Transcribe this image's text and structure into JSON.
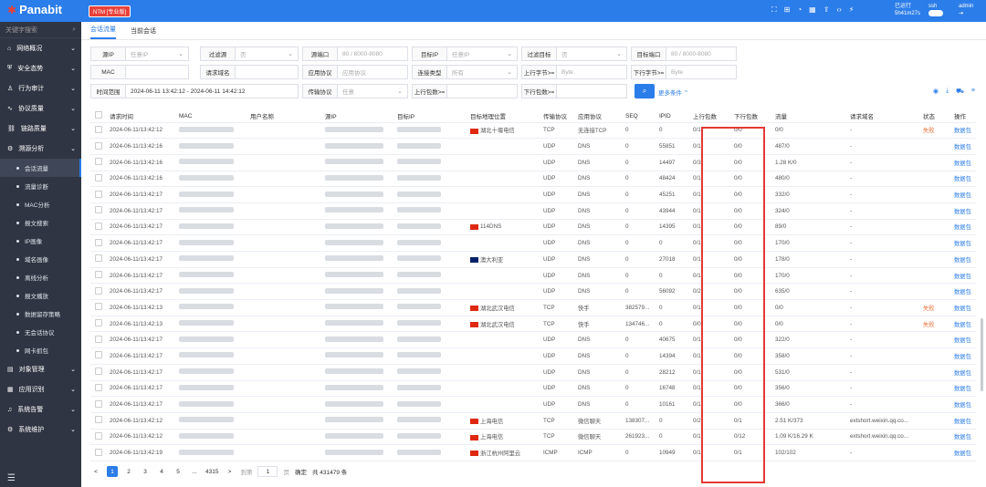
{
  "app": {
    "logo": "Panabit",
    "edition": "NTM [专业版]",
    "status_line1": "已运行",
    "status_line2": "5h41m27s",
    "user": "ssh",
    "admin": "admin"
  },
  "sidebar": {
    "search_placeholder": "关键字搜索",
    "items": [
      {
        "label": "网络概况",
        "icon": "home-icon",
        "expandable": true
      },
      {
        "label": "安全态势",
        "icon": "shield-icon",
        "expandable": true
      },
      {
        "label": "行为审计",
        "icon": "user-icon",
        "expandable": true
      },
      {
        "label": "协议质量",
        "icon": "pulse-icon",
        "expandable": true
      },
      {
        "label": "链路质量",
        "icon": "link-icon",
        "expandable": true
      },
      {
        "label": "溯源分析",
        "icon": "trace-icon",
        "expandable": true
      }
    ],
    "subitems": [
      "会话流量",
      "流量诊断",
      "MAC分析",
      "报文搜索",
      "IP画像",
      "域名画像",
      "离线分析",
      "报文播放",
      "数据留存策略",
      "无会话协议",
      "网卡抓包"
    ],
    "bottom_items": [
      {
        "label": "对象管理",
        "icon": "db-icon"
      },
      {
        "label": "应用识别",
        "icon": "grid-icon"
      },
      {
        "label": "系统告警",
        "icon": "bell-icon"
      },
      {
        "label": "系统维护",
        "icon": "gear-icon"
      }
    ]
  },
  "tabs": [
    "会话流量",
    "当前会话"
  ],
  "filters": {
    "r1": [
      {
        "label": "源IP",
        "value": "任意IP",
        "dd": true
      },
      {
        "label": "过滤源",
        "value": "否",
        "dd": true
      },
      {
        "label": "源端口",
        "value": "80 / 8000-8080"
      },
      {
        "label": "目标IP",
        "value": "任意IP",
        "dd": true
      },
      {
        "label": "过滤目标",
        "value": "否",
        "dd": true
      },
      {
        "label": "目标端口",
        "value": "80 / 8000-8080"
      }
    ],
    "r2": [
      {
        "label": "MAC",
        "value": ""
      },
      {
        "label": "请求域名",
        "value": ""
      },
      {
        "label": "应用协议",
        "value": "应用协议"
      },
      {
        "label": "连接类型",
        "value": "所有",
        "dd": true
      },
      {
        "label": "上行字节>=",
        "value": "Byte"
      },
      {
        "label": "下行字节>=",
        "value": "Byte"
      }
    ],
    "r3": [
      {
        "label": "时间范围",
        "value": "2024-06-11 13:42:12 - 2024-06-11 14:42:12"
      },
      {
        "label": "传输协议",
        "value": "任意",
        "dd": true
      },
      {
        "label": "上行包数>=",
        "value": ""
      },
      {
        "label": "下行包数>=",
        "value": ""
      }
    ],
    "more": "更多条件"
  },
  "table": {
    "headers": [
      "请求时间",
      "MAC",
      "用户名称",
      "源IP",
      "目标IP",
      "目标地理位置",
      "传输协议",
      "应用协议",
      "SEQ",
      "IPID",
      "上行包数",
      "下行包数",
      "流量",
      "请求域名",
      "状态",
      "操作"
    ],
    "rows": [
      [
        "2024-06-11/13:42:12",
        "",
        "",
        "",
        "",
        "湖北十堰电信",
        "TCP",
        "无连接TCP",
        "0",
        "0",
        "0/1",
        "0/0",
        "0/0",
        "-",
        "失败",
        "数据包"
      ],
      [
        "2024-06-11/13:42:16",
        "",
        "",
        "",
        "",
        "",
        "UDP",
        "DNS",
        "0",
        "55851",
        "0/1",
        "0/0",
        "487/0",
        "-",
        "",
        "数据包"
      ],
      [
        "2024-06-11/13:42:16",
        "",
        "",
        "",
        "",
        "",
        "UDP",
        "DNS",
        "0",
        "14497",
        "0/3",
        "0/0",
        "1.28 K/0",
        "-",
        "",
        "数据包"
      ],
      [
        "2024-06-11/13:42:16",
        "",
        "",
        "",
        "",
        "",
        "UDP",
        "DNS",
        "0",
        "48424",
        "0/1",
        "0/0",
        "480/0",
        "-",
        "",
        "数据包"
      ],
      [
        "2024-06-11/13:42:17",
        "",
        "",
        "",
        "",
        "",
        "UDP",
        "DNS",
        "0",
        "45251",
        "0/1",
        "0/0",
        "332/0",
        "-",
        "",
        "数据包"
      ],
      [
        "2024-06-11/13:42:17",
        "",
        "",
        "",
        "",
        "",
        "UDP",
        "DNS",
        "0",
        "43944",
        "0/1",
        "0/0",
        "324/0",
        "-",
        "",
        "数据包"
      ],
      [
        "2024-06-11/13:42:17",
        "",
        "",
        "",
        "",
        "114DNS",
        "UDP",
        "DNS",
        "0",
        "14395",
        "0/1",
        "0/0",
        "89/0",
        "-",
        "",
        "数据包"
      ],
      [
        "2024-06-11/13:42:17",
        "",
        "",
        "",
        "",
        "",
        "UDP",
        "DNS",
        "0",
        "0",
        "0/1",
        "0/0",
        "170/0",
        "-",
        "",
        "数据包"
      ],
      [
        "2024-06-11/13:42:17",
        "",
        "",
        "",
        "",
        "澳大利亚",
        "UDP",
        "DNS",
        "0",
        "27018",
        "0/1",
        "0/0",
        "178/0",
        "-",
        "",
        "数据包"
      ],
      [
        "2024-06-11/13:42:17",
        "",
        "",
        "",
        "",
        "",
        "UDP",
        "DNS",
        "0",
        "0",
        "0/1",
        "0/0",
        "170/0",
        "-",
        "",
        "数据包"
      ],
      [
        "2024-06-11/13:42:17",
        "",
        "",
        "",
        "",
        "",
        "UDP",
        "DNS",
        "0",
        "56092",
        "0/2",
        "0/0",
        "635/0",
        "-",
        "",
        "数据包"
      ],
      [
        "2024-06-11/13:42:13",
        "",
        "",
        "",
        "",
        "湖北武汉电信",
        "TCP",
        "快手",
        "382579...",
        "0",
        "0/1",
        "0/0",
        "0/0",
        "-",
        "失败",
        "数据包"
      ],
      [
        "2024-06-11/13:42:13",
        "",
        "",
        "",
        "",
        "湖北武汉电信",
        "TCP",
        "快手",
        "134746...",
        "0",
        "0/0",
        "0/0",
        "0/0",
        "-",
        "失败",
        "数据包"
      ],
      [
        "2024-06-11/13:42:17",
        "",
        "",
        "",
        "",
        "",
        "UDP",
        "DNS",
        "0",
        "40675",
        "0/1",
        "0/0",
        "322/0",
        "-",
        "",
        "数据包"
      ],
      [
        "2024-06-11/13:42:17",
        "",
        "",
        "",
        "",
        "",
        "UDP",
        "DNS",
        "0",
        "14394",
        "0/1",
        "0/0",
        "358/0",
        "-",
        "",
        "数据包"
      ],
      [
        "2024-06-11/13:42:17",
        "",
        "",
        "",
        "",
        "",
        "UDP",
        "DNS",
        "0",
        "28212",
        "0/1",
        "0/0",
        "531/0",
        "-",
        "",
        "数据包"
      ],
      [
        "2024-06-11/13:42:17",
        "",
        "",
        "",
        "",
        "",
        "UDP",
        "DNS",
        "0",
        "16748",
        "0/1",
        "0/0",
        "356/0",
        "-",
        "",
        "数据包"
      ],
      [
        "2024-06-11/13:42:17",
        "",
        "",
        "",
        "",
        "",
        "UDP",
        "DNS",
        "0",
        "10161",
        "0/1",
        "0/0",
        "366/0",
        "-",
        "",
        "数据包"
      ],
      [
        "2024-06-11/13:42:12",
        "",
        "",
        "",
        "",
        "上海电信",
        "TCP",
        "微信聊天",
        "138307...",
        "0",
        "0/2",
        "0/1",
        "2.51 K/373",
        "extshort.weixin.qq.co...",
        "",
        "数据包"
      ],
      [
        "2024-06-11/13:42:12",
        "",
        "",
        "",
        "",
        "上海电信",
        "TCP",
        "微信聊天",
        "261923...",
        "0",
        "0/1",
        "0/12",
        "1.09 K/16.29 K",
        "extshort.weixin.qq.co...",
        "",
        "数据包"
      ],
      [
        "2024-06-11/13:42:19",
        "",
        "",
        "",
        "",
        "浙江杭州阿里云",
        "ICMP",
        "ICMP",
        "0",
        "10949",
        "0/1",
        "0/1",
        "102/102",
        "-",
        "",
        "数据包"
      ]
    ]
  },
  "pager": {
    "pages": [
      "1",
      "2",
      "3",
      "4",
      "5",
      "...",
      "4315"
    ],
    "prev": "<",
    "next": ">",
    "goto_label": "到第",
    "goto_value": "1",
    "page_unit": "页",
    "confirm": "确定",
    "total": "共 431479 条"
  }
}
